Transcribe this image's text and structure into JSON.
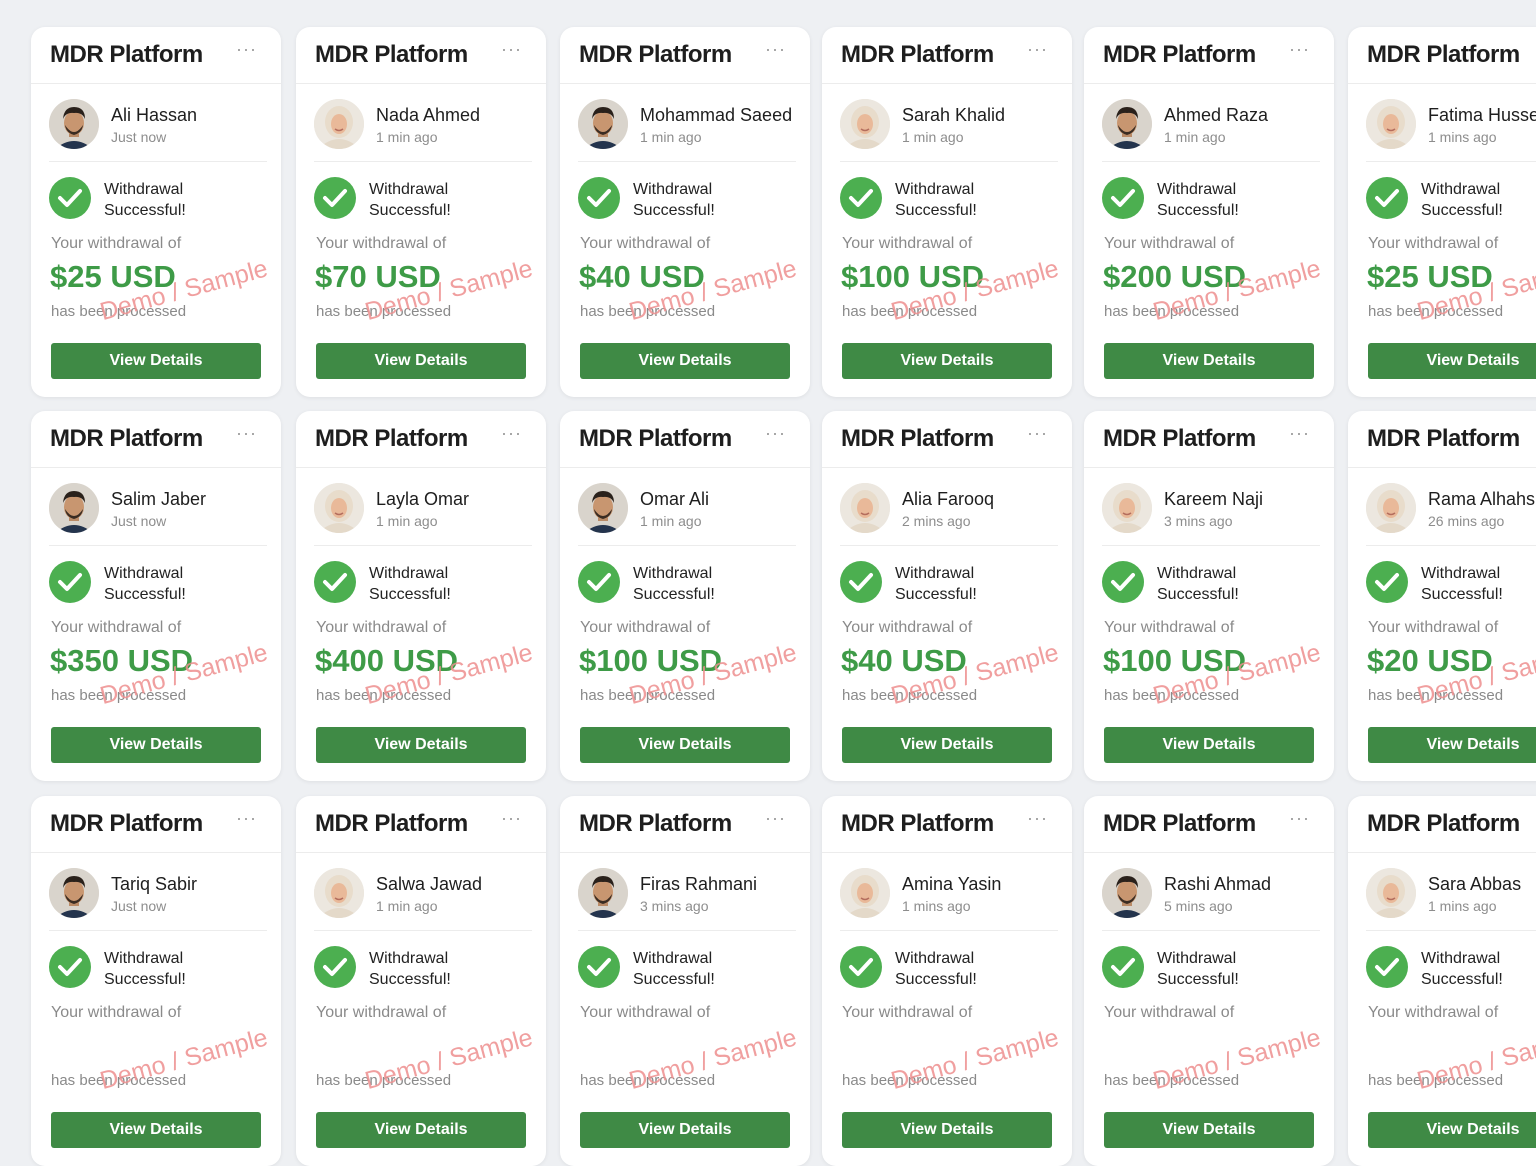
{
  "platform_title": "MDR Platform",
  "more_icon": "···",
  "status_line1": "Withdrawal",
  "status_line2": "Successful!",
  "withdraw_label": "Your withdrawal of",
  "desc_text": "has been processed",
  "watermark_text": "Demo / Sample",
  "button_label": "View Details",
  "colors": {
    "accent_green": "#4caf50",
    "button_green": "#3f8a45",
    "amount_green": "#3e9b47",
    "watermark": "#ee8f8f"
  },
  "cards": [
    {
      "name": "Ali Hassan",
      "time": "Just now",
      "amount": "$25 USD",
      "avatar": "male-avatar"
    },
    {
      "name": "Nada Ahmed",
      "time": "1 min ago",
      "amount": "$70 USD",
      "avatar": "female-avatar"
    },
    {
      "name": "Mohammad Saeed",
      "time": "1 min ago",
      "amount": "$40 USD",
      "avatar": "male-avatar"
    },
    {
      "name": "Sarah Khalid",
      "time": "1 min ago",
      "amount": "$100 USD",
      "avatar": "female-avatar"
    },
    {
      "name": "Ahmed Raza",
      "time": "1 min ago",
      "amount": "$200 USD",
      "avatar": "male-avatar"
    },
    {
      "name": "Fatima Husse",
      "time": "1 mins ago",
      "amount": "$25 USD",
      "avatar": "female-avatar"
    },
    {
      "name": "Salim Jaber",
      "time": "Just now",
      "amount": "$350 USD",
      "avatar": "male-avatar"
    },
    {
      "name": "Layla Omar",
      "time": "1 min ago",
      "amount": "$400 USD",
      "avatar": "female-avatar"
    },
    {
      "name": "Omar Ali",
      "time": "1 min ago",
      "amount": "$100 USD",
      "avatar": "male-avatar"
    },
    {
      "name": "Alia Farooq",
      "time": "2 mins ago",
      "amount": "$40 USD",
      "avatar": "female-avatar"
    },
    {
      "name": "Kareem Naji",
      "time": "3 mins ago",
      "amount": "$100 USD",
      "avatar": "female-avatar"
    },
    {
      "name": "Rama Alhahs",
      "time": "26 mins ago",
      "amount": "$20 USD",
      "avatar": "female-avatar"
    },
    {
      "name": "Tariq Sabir",
      "time": "Just now",
      "amount": "",
      "avatar": "male-avatar"
    },
    {
      "name": "Salwa Jawad",
      "time": "1 min ago",
      "amount": "",
      "avatar": "female-avatar"
    },
    {
      "name": "Firas Rahmani",
      "time": "3 mins ago",
      "amount": "",
      "avatar": "male-avatar"
    },
    {
      "name": "Amina Yasin",
      "time": "1 mins ago",
      "amount": "",
      "avatar": "female-avatar"
    },
    {
      "name": "Rashi Ahmad",
      "time": "5 mins ago",
      "amount": "",
      "avatar": "male-avatar"
    },
    {
      "name": "Sara Abbas",
      "time": "1 mins ago",
      "amount": "",
      "avatar": "female-avatar"
    }
  ]
}
